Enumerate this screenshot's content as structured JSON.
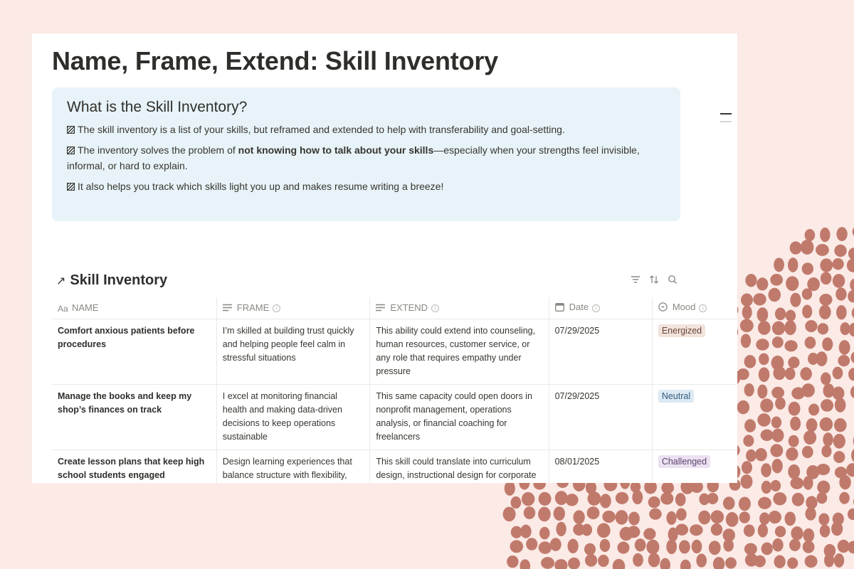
{
  "page": {
    "title": "Name, Frame, Extend: Skill Inventory"
  },
  "callout": {
    "title": "What is the Skill Inventory?",
    "line1": "The skill inventory is a list of your skills, but reframed and extended to help with transferability and goal-setting.",
    "line2_before": "The inventory solves the problem of ",
    "line2_bold": "not knowing how to talk about your skills",
    "line2_after": "—especially when your strengths feel invisible, informal, or hard to explain.",
    "line3": "It also helps you track which skills light you up and makes resume writing a breeze!",
    "icon": "striped-square-icon"
  },
  "database": {
    "link_icon": "↗",
    "title": "Skill Inventory",
    "tools": [
      "filter-icon",
      "sort-icon",
      "search-icon"
    ],
    "columns": [
      {
        "label": "NAME",
        "icon": "Aa"
      },
      {
        "label": "FRAME",
        "icon": "text-lines-icon"
      },
      {
        "label": "EXTEND",
        "icon": "text-lines-icon"
      },
      {
        "label": "Date",
        "icon": "calendar-icon"
      },
      {
        "label": "Mood",
        "icon": "select-icon"
      }
    ],
    "rows": [
      {
        "name": "Comfort anxious patients before procedures",
        "frame": "I’m skilled at building trust quickly and helping people feel calm in stressful situations",
        "extend": "This ability could extend into counseling, human resources, customer service, or any role that requires empathy under pressure",
        "date": "07/29/2025",
        "mood": "Energized"
      },
      {
        "name": "Manage the books and keep my shop’s finances on track",
        "frame": "I excel at monitoring financial health and making data-driven decisions to keep operations sustainable",
        "extend": "This same capacity could open doors in nonprofit management, operations analysis, or financial coaching for freelancers",
        "date": "07/29/2025",
        "mood": "Neutral"
      },
      {
        "name": "Create lesson plans that keep high school students engaged",
        "frame": "Design learning experiences that balance structure with flexibility,",
        "extend": "This skill could translate into curriculum design, instructional design for corporate",
        "date": "08/01/2025",
        "mood": "Challenged"
      }
    ]
  },
  "colors": {
    "background": "#fbeae6",
    "dots": "#c07a6c",
    "callout_bg": "#e7f3f8",
    "tag_energized_bg": "#f1e3dc",
    "tag_neutral_bg": "#dde9f3",
    "tag_challenged_bg": "#ebe1f1"
  }
}
